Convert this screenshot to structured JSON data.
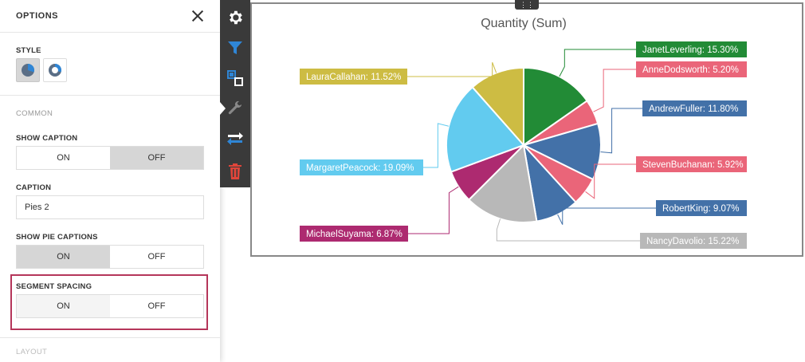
{
  "options_panel": {
    "title": "OPTIONS",
    "style": {
      "label": "STYLE",
      "options": [
        {
          "name": "pie-style-icon",
          "selected": true
        },
        {
          "name": "donut-style-icon",
          "selected": false
        }
      ]
    },
    "common_group": "COMMON",
    "show_caption": {
      "label": "SHOW CAPTION",
      "on": "ON",
      "off": "OFF",
      "value": "OFF"
    },
    "caption": {
      "label": "CAPTION",
      "value": "Pies 2"
    },
    "show_pie_captions": {
      "label": "SHOW PIE CAPTIONS",
      "on": "ON",
      "off": "OFF",
      "value": "ON"
    },
    "segment_spacing": {
      "label": "SEGMENT SPACING",
      "on": "ON",
      "off": "OFF",
      "value": "OFF"
    },
    "layout_group": "LAYOUT"
  },
  "toolbar": {
    "buttons": [
      "gear-icon",
      "filter-icon",
      "layout-icon",
      "wrench-icon",
      "swap-icon",
      "trash-icon"
    ],
    "colors": {
      "gear": "#ffffff",
      "filter": "#2f86d6",
      "layout": "#2f86d6",
      "wrench": "#888888",
      "swap": "#2f86d6",
      "trash": "#e0453a"
    }
  },
  "drag_handle": "⋮⋮",
  "chart_data": {
    "type": "pie",
    "title": "Quantity (Sum)",
    "slices": [
      {
        "name": "JanetLeverling",
        "value": 15.3,
        "label": "JanetLeverling: 15.30%",
        "color": "#228b36"
      },
      {
        "name": "AnneDodsworth",
        "value": 5.2,
        "label": "AnneDodsworth: 5.20%",
        "color": "#ea6579"
      },
      {
        "name": "AndrewFuller",
        "value": 11.8,
        "label": "AndrewFuller: 11.80%",
        "color": "#4371a8"
      },
      {
        "name": "StevenBuchanan",
        "value": 5.92,
        "label": "StevenBuchanan: 5.92%",
        "color": "#ea6579"
      },
      {
        "name": "RobertKing",
        "value": 9.07,
        "label": "RobertKing: 9.07%",
        "color": "#4371a8"
      },
      {
        "name": "NancyDavolio",
        "value": 15.22,
        "label": "NancyDavolio: 15.22%",
        "color": "#b8b8b8"
      },
      {
        "name": "MichaelSuyama",
        "value": 6.87,
        "label": "MichaelSuyama: 6.87%",
        "color": "#ad2a70"
      },
      {
        "name": "MargaretPeacock",
        "value": 19.09,
        "label": "MargaretPeacock: 19.09%",
        "color": "#62cbef"
      },
      {
        "name": "LauraCallahan",
        "value": 11.52,
        "label": "LauraCallahan: 11.52%",
        "color": "#cdbc43"
      }
    ]
  }
}
